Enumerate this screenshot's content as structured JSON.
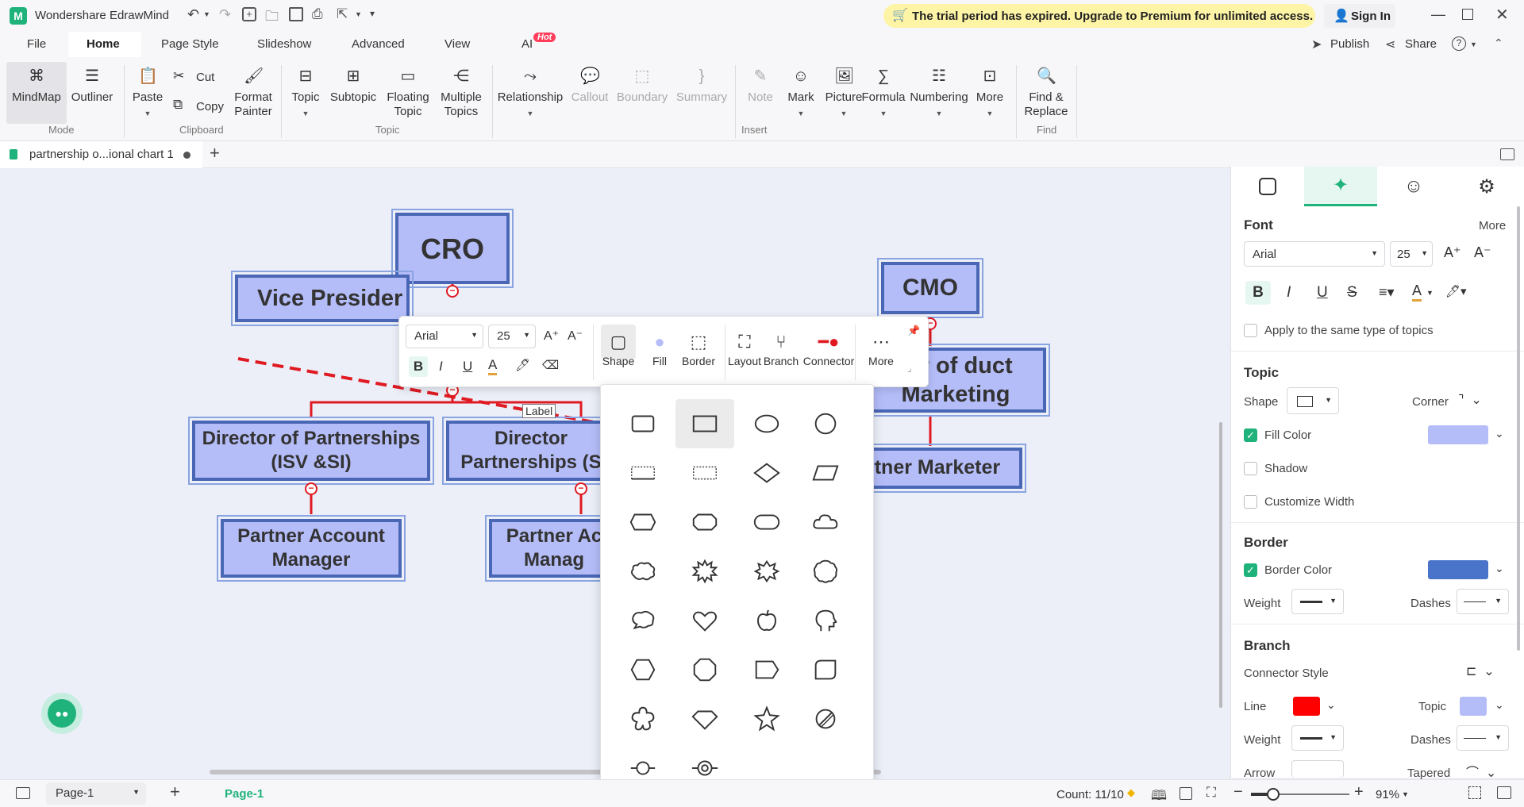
{
  "app": {
    "title": "Wondershare EdrawMind",
    "trial_banner": "The trial period has expired. Upgrade to Premium for unlimited access.",
    "sign_in": "Sign In",
    "publish": "Publish",
    "share": "Share"
  },
  "menu_tabs": [
    "File",
    "Home",
    "Page Style",
    "Slideshow",
    "Advanced",
    "View",
    "AI"
  ],
  "ai_badge": "Hot",
  "ribbon": {
    "mindmap": "MindMap",
    "outliner": "Outliner",
    "mode_group": "Mode",
    "paste": "Paste",
    "cut": "Cut",
    "copy": "Copy",
    "format_painter": "Format Painter",
    "clipboard_group": "Clipboard",
    "topic": "Topic",
    "subtopic": "Subtopic",
    "floating_topic": "Floating Topic",
    "multiple_topics": "Multiple Topics",
    "topic_group": "Topic",
    "relationship": "Relationship",
    "callout": "Callout",
    "boundary": "Boundary",
    "summary": "Summary",
    "note": "Note",
    "mark": "Mark",
    "picture": "Picture",
    "formula": "Formula",
    "numbering": "Numbering",
    "more": "More",
    "insert_group": "Insert",
    "find_replace": "Find & Replace",
    "find_group": "Find"
  },
  "doc_tab": {
    "name": "partnership o...ional chart 1"
  },
  "nodes": {
    "cro": "CRO",
    "cmo": "CMO",
    "vp": "Vice Presider",
    "dir_isv": "Director of Partnerships (ISV &SI)",
    "dir_s": "Director Partnerships (S",
    "pam1": "Partner Account Manager",
    "pam2": "Partner Ac Manag",
    "dir_pm": "tor of duct Marketing",
    "partner_marketer": "rtner Marketer",
    "label": "Label"
  },
  "floatbar": {
    "font": "Arial",
    "size": "25",
    "shape": "Shape",
    "fill": "Fill",
    "border": "Border",
    "layout": "Layout",
    "branch": "Branch",
    "connector": "Connector",
    "more": "More"
  },
  "panel": {
    "font_title": "Font",
    "more": "More",
    "font_name": "Arial",
    "font_size": "25",
    "apply_same": "Apply to the same type of topics",
    "topic_title": "Topic",
    "shape": "Shape",
    "corner": "Corner",
    "fill_color": "Fill Color",
    "shadow": "Shadow",
    "customize_width": "Customize Width",
    "border_title": "Border",
    "border_color": "Border Color",
    "weight": "Weight",
    "dashes": "Dashes",
    "branch_title": "Branch",
    "connector_style": "Connector Style",
    "line": "Line",
    "topic": "Topic",
    "weight2": "Weight",
    "dashes2": "Dashes",
    "arrow": "Arrow",
    "tapered": "Tapered"
  },
  "colors": {
    "fill": "#b5bdf9",
    "border": "#4a74c9",
    "line": "#ff0000",
    "accent": "#1fb37b"
  },
  "status": {
    "page_select": "Page-1",
    "page_tab": "Page-1",
    "count": "Count: 11/10",
    "zoom": "91%"
  }
}
